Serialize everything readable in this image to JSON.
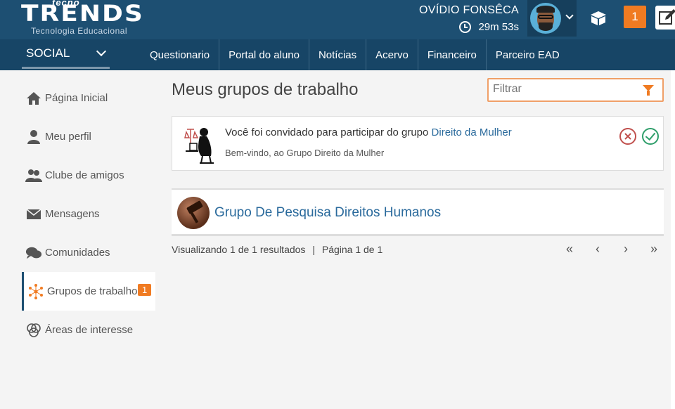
{
  "header": {
    "logo_top": "tecno",
    "logo_main": "TRENDS",
    "logo_sub": "Tecnologia Educacional",
    "user_name": "OVÍDIO FONSÊCA",
    "timer": "29m 53s",
    "notification_count": "1"
  },
  "nav": {
    "social_label": "SOCIAL",
    "items": [
      "Questionario",
      "Portal do aluno",
      "Notícias",
      "Acervo",
      "Financeiro",
      "Parceiro EAD"
    ]
  },
  "sidebar": {
    "items": [
      {
        "label": "Página Inicial",
        "icon": "home-icon"
      },
      {
        "label": "Meu perfil",
        "icon": "user-icon"
      },
      {
        "label": "Clube de amigos",
        "icon": "users-icon"
      },
      {
        "label": "Mensagens",
        "icon": "envelope-icon"
      },
      {
        "label": "Comunidades",
        "icon": "chat-icon"
      },
      {
        "label": "Grupos de trabalho",
        "icon": "network-icon",
        "badge": "1",
        "active": true
      },
      {
        "label": "Áreas de interesse",
        "icon": "circles-icon"
      }
    ]
  },
  "main": {
    "title": "Meus grupos de trabalho",
    "filter_placeholder": "Filtrar",
    "invite": {
      "text": "Você foi convidado para participar do grupo ",
      "group_link": "Direito da Mulher",
      "subtitle": "Bem-vindo, ao Grupo Direito da Mulher"
    },
    "group": {
      "name": "Grupo De Pesquisa Direitos Humanos"
    },
    "pager": {
      "results": "Visualizando 1 de 1 resultados",
      "separator": "|",
      "page": "Página 1 de 1",
      "first": "«",
      "prev": "‹",
      "next": "›",
      "last": "»"
    }
  },
  "colors": {
    "header_bg": "#1d4f72",
    "nav_bg": "#174566",
    "accent": "#f07b22",
    "link": "#2a6a9c"
  }
}
